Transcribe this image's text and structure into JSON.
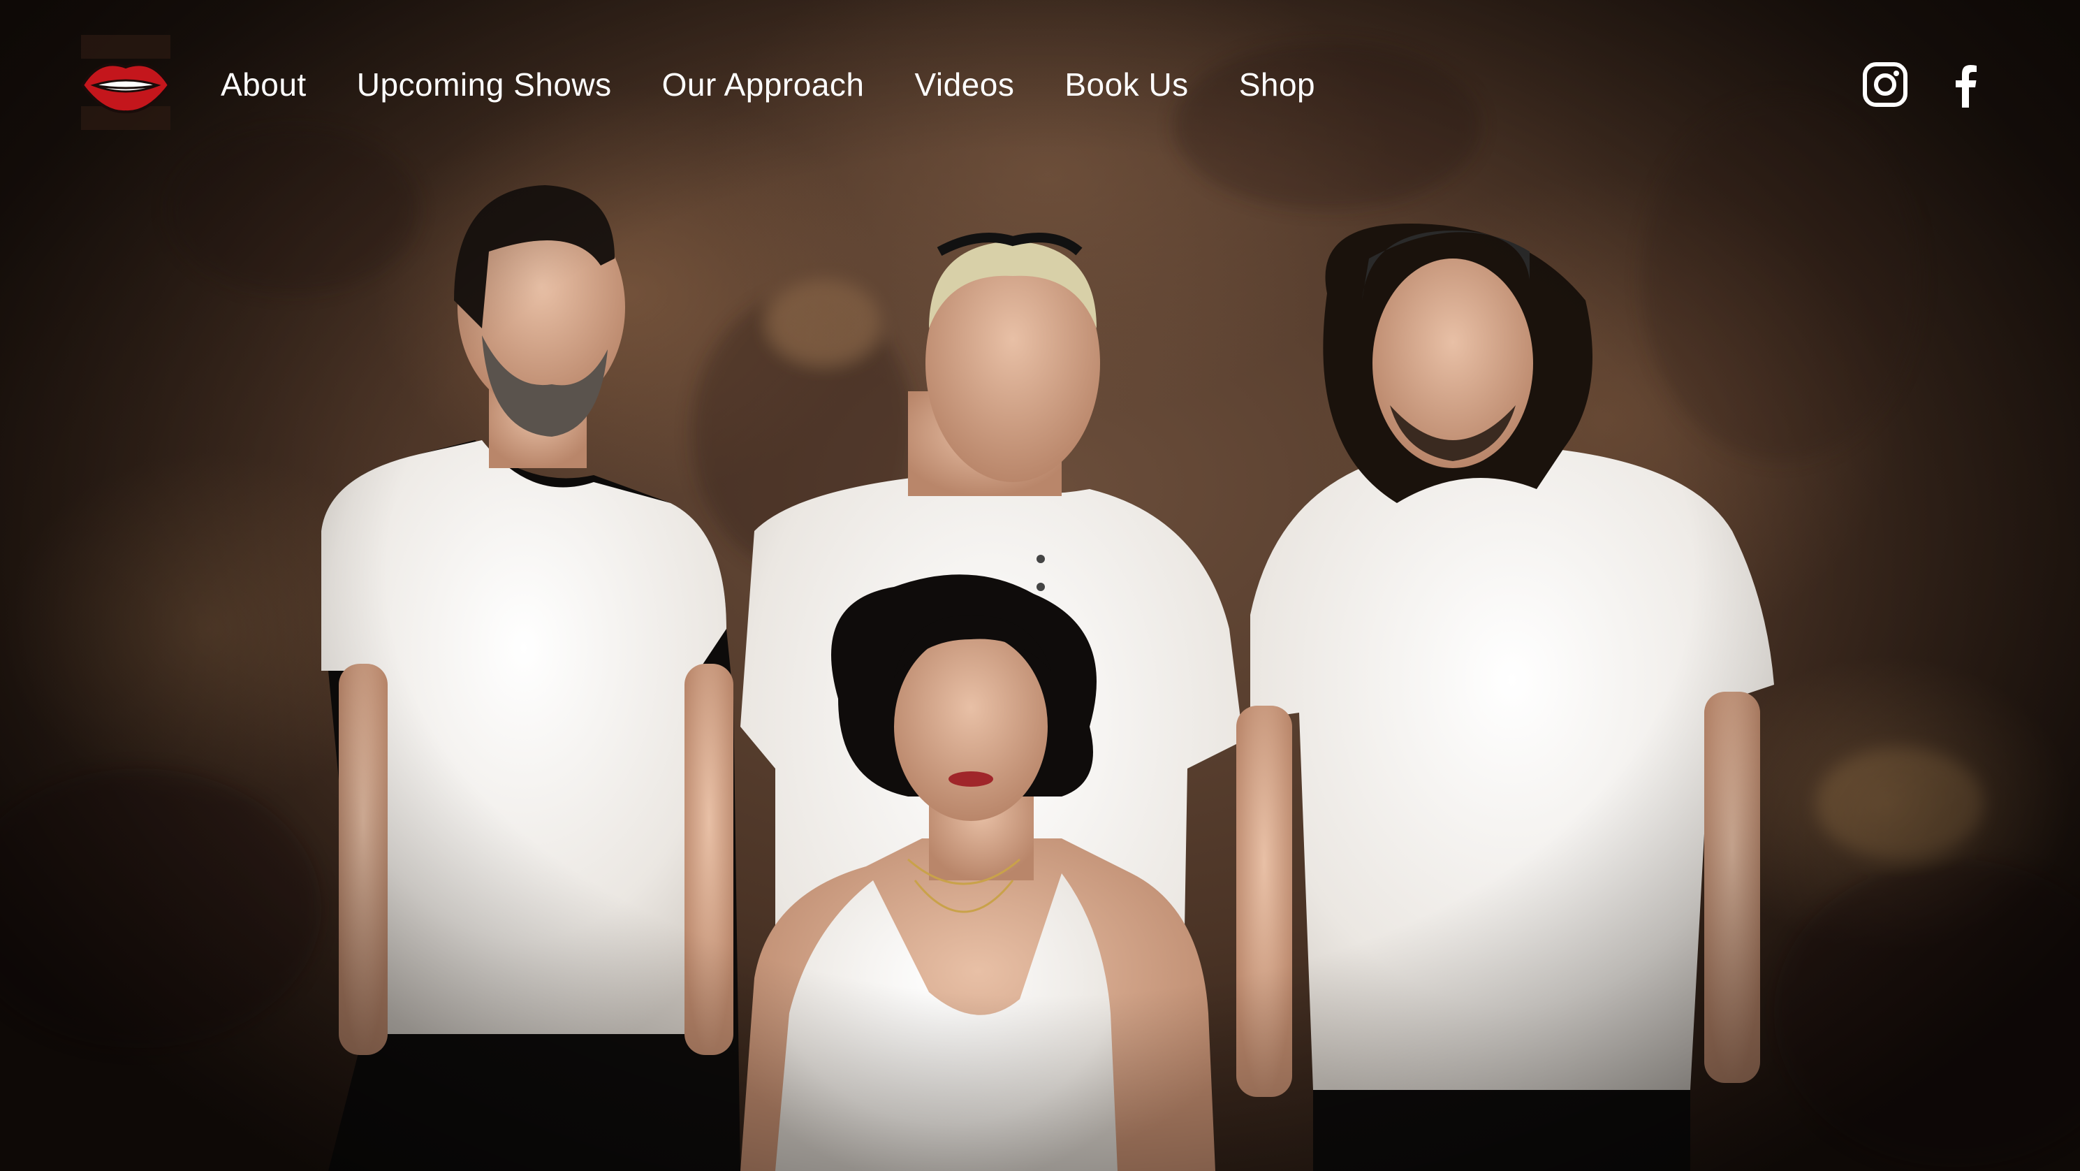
{
  "site": {
    "logo_icon": "lips-logo-icon"
  },
  "nav": {
    "items": [
      {
        "label": "About"
      },
      {
        "label": "Upcoming Shows"
      },
      {
        "label": "Our Approach"
      },
      {
        "label": "Videos"
      },
      {
        "label": "Book Us"
      },
      {
        "label": "Shop"
      }
    ]
  },
  "social": {
    "instagram_icon": "instagram-icon",
    "facebook_icon": "facebook-icon"
  },
  "colors": {
    "nav_text": "#ffffff",
    "logo_red": "#c4161c",
    "backdrop": "#4b3426",
    "shirts": "#f2efea"
  }
}
